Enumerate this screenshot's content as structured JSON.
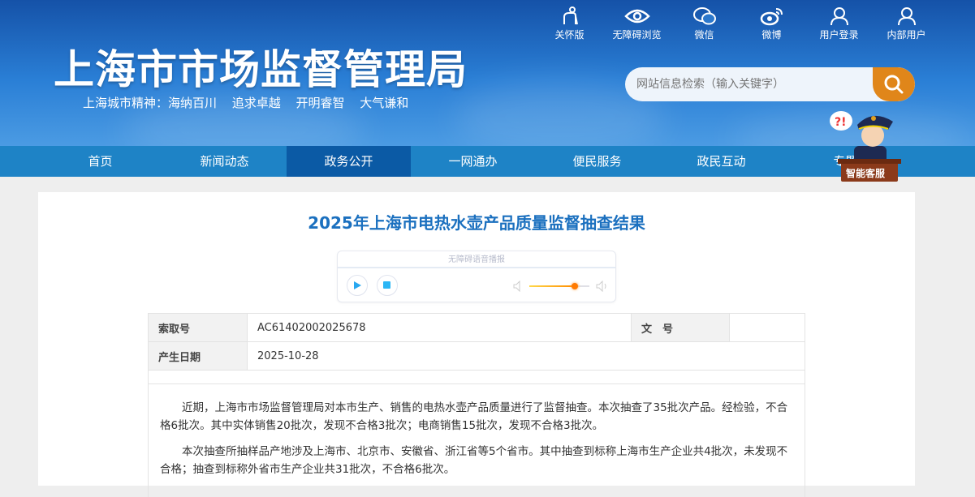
{
  "header": {
    "site_title": "上海市市场监督管理局",
    "motto": "上海城市精神：海纳百川 追求卓越 开明睿智 大气谦和",
    "tools": [
      {
        "label": "关怀版",
        "icon": "elderly-icon"
      },
      {
        "label": "无障碍浏览",
        "icon": "eye-icon"
      },
      {
        "label": "微信",
        "icon": "wechat-icon"
      },
      {
        "label": "微博",
        "icon": "weibo-icon"
      },
      {
        "label": "用户登录",
        "icon": "user-icon"
      },
      {
        "label": "内部用户",
        "icon": "user-icon"
      }
    ],
    "search_placeholder": "网站信息检索（输入关键字）"
  },
  "nav": {
    "items": [
      "首页",
      "新闻动态",
      "政务公开",
      "一网通办",
      "便民服务",
      "政民互动",
      "专题"
    ],
    "active": "政务公开"
  },
  "assistant": {
    "label": "智能客服"
  },
  "article": {
    "title": "2025年上海市电热水壶产品质量监督抽查结果",
    "player": {
      "title": "无障碍语音播报",
      "volume": 0.75
    },
    "meta": {
      "index_label": "索取号",
      "index_value": "AC61402002025678",
      "doc_label": "文　号",
      "doc_value": "",
      "date_label": "产生日期",
      "date_value": "2025-10-28"
    },
    "paragraphs": [
      "近期，上海市市场监督管理局对本市生产、销售的电热水壶产品质量进行了监督抽查。本次抽查了35批次产品。经检验，不合格6批次。其中实体销售20批次，发现不合格3批次；电商销售15批次，发现不合格3批次。",
      "本次抽查所抽样品产地涉及上海市、北京市、安徽省、浙江省等5个省市。其中抽查到标称上海市生产企业共4批次，未发现不合格；抽查到标称外省市生产企业共31批次，不合格6批次。"
    ]
  }
}
